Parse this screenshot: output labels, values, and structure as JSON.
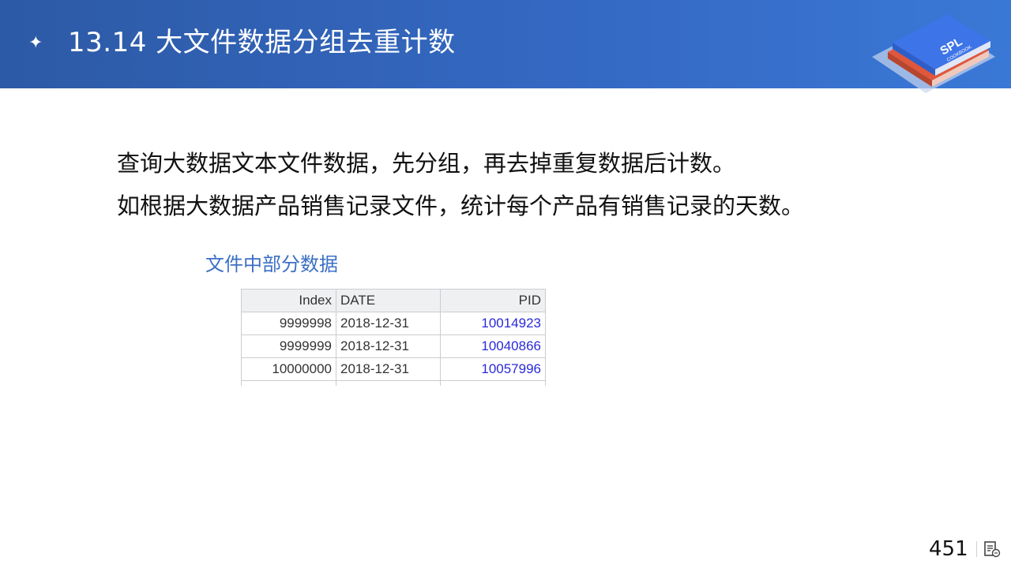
{
  "slide": {
    "bullet_glyph": "✦",
    "title": "13.14 大文件数据分组去重计数",
    "logo": {
      "name": "spl-cookbook-logo",
      "text_main": "SPL",
      "text_sub": "COOKBOOK"
    },
    "body_lines": [
      "查询大数据文本文件数据，先分组，再去掉重复数据后计数。",
      "如根据大数据产品销售记录文件，统计每个产品有销售记录的天数。"
    ],
    "caption": "文件中部分数据",
    "page_number": "451"
  },
  "table": {
    "columns": [
      "Index",
      "DATE",
      "PID"
    ],
    "rows": [
      [
        "9999998",
        "2018-12-31",
        "10014923"
      ],
      [
        "9999999",
        "2018-12-31",
        "10040866"
      ],
      [
        "10000000",
        "2018-12-31",
        "10057996"
      ]
    ]
  },
  "colors": {
    "header_bg": "#3468c2",
    "caption": "#3b6fc4",
    "pid_text": "#2a2adb"
  }
}
